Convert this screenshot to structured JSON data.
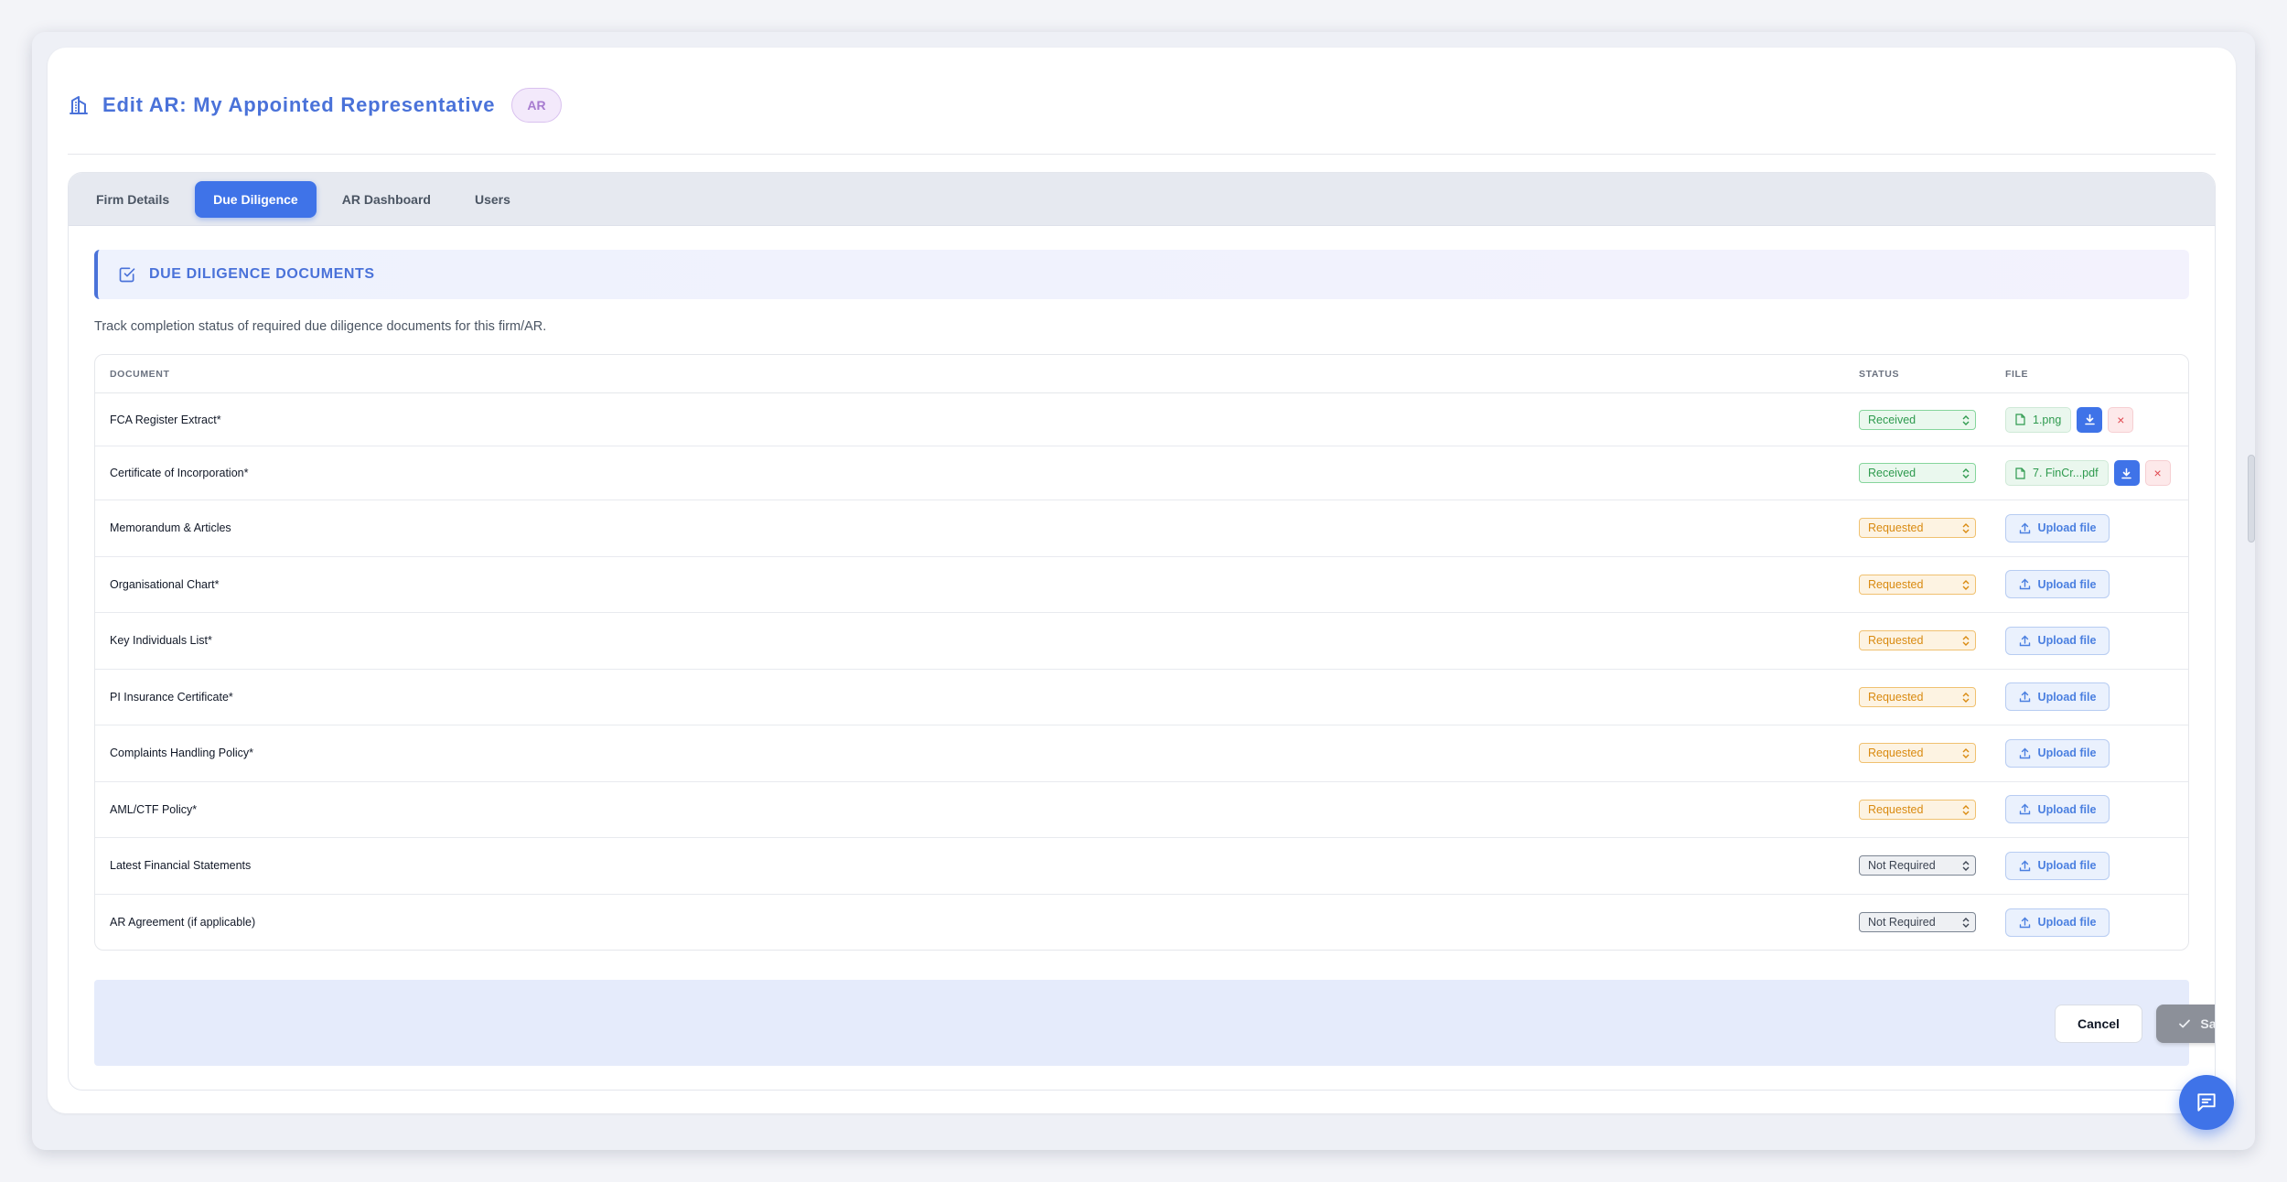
{
  "header": {
    "title": "Edit AR: My Appointed Representative",
    "badge": "AR",
    "icon": "building-icon"
  },
  "tabs": [
    {
      "label": "Firm Details",
      "active": false
    },
    {
      "label": "Due Diligence",
      "active": true
    },
    {
      "label": "AR Dashboard",
      "active": false
    },
    {
      "label": "Users",
      "active": false
    }
  ],
  "section": {
    "title": "DUE DILIGENCE DOCUMENTS",
    "icon": "checkbox-icon",
    "description": "Track completion status of required due diligence documents for this firm/AR."
  },
  "table": {
    "columns": {
      "document": "DOCUMENT",
      "status": "STATUS",
      "file": "FILE"
    },
    "rows": [
      {
        "document": "FCA Register Extract*",
        "status": "Received",
        "file": "1.png"
      },
      {
        "document": "Certificate of Incorporation*",
        "status": "Received",
        "file": "7. FinCr...pdf"
      },
      {
        "document": "Memorandum & Articles",
        "status": "Requested",
        "file": ""
      },
      {
        "document": "Organisational Chart*",
        "status": "Requested",
        "file": ""
      },
      {
        "document": "Key Individuals List*",
        "status": "Requested",
        "file": ""
      },
      {
        "document": "PI Insurance Certificate*",
        "status": "Requested",
        "file": ""
      },
      {
        "document": "Complaints Handling Policy*",
        "status": "Requested",
        "file": ""
      },
      {
        "document": "AML/CTF Policy*",
        "status": "Requested",
        "file": ""
      },
      {
        "document": "Latest Financial Statements",
        "status": "Not Required",
        "file": ""
      },
      {
        "document": "AR Agreement (if applicable)",
        "status": "Not Required",
        "file": ""
      }
    ],
    "upload_label": "Upload file",
    "remove_symbol": "×"
  },
  "footer": {
    "cancel_label": "Cancel",
    "saved_label": "Saved"
  },
  "colors": {
    "accent": "#3f73e8",
    "received": "#2e9a4e",
    "requested": "#d98a10",
    "not_required": "#3c4452"
  }
}
